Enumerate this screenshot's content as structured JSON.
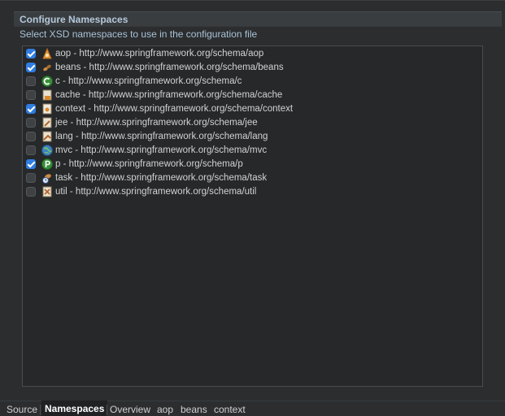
{
  "header": {
    "title": "Configure Namespaces",
    "description": "Select XSD namespaces to use in the configuration file"
  },
  "namespaces": [
    {
      "label": "aop - http://www.springframework.org/schema/aop",
      "checked": true,
      "icon": "aop-icon"
    },
    {
      "label": "beans - http://www.springframework.org/schema/beans",
      "checked": true,
      "icon": "beans-icon"
    },
    {
      "label": "c - http://www.springframework.org/schema/c",
      "checked": false,
      "icon": "c-namespace-icon"
    },
    {
      "label": "cache - http://www.springframework.org/schema/cache",
      "checked": false,
      "icon": "cache-icon"
    },
    {
      "label": "context - http://www.springframework.org/schema/context",
      "checked": true,
      "icon": "context-icon"
    },
    {
      "label": "jee - http://www.springframework.org/schema/jee",
      "checked": false,
      "icon": "jee-icon"
    },
    {
      "label": "lang - http://www.springframework.org/schema/lang",
      "checked": false,
      "icon": "lang-icon"
    },
    {
      "label": "mvc - http://www.springframework.org/schema/mvc",
      "checked": false,
      "icon": "mvc-globe-icon"
    },
    {
      "label": "p - http://www.springframework.org/schema/p",
      "checked": true,
      "icon": "p-namespace-icon"
    },
    {
      "label": "task - http://www.springframework.org/schema/task",
      "checked": false,
      "icon": "task-icon"
    },
    {
      "label": "util - http://www.springframework.org/schema/util",
      "checked": false,
      "icon": "util-icon"
    }
  ],
  "tabs": [
    {
      "label": "Source",
      "active": false
    },
    {
      "label": "Namespaces",
      "active": true
    },
    {
      "label": "Overview",
      "active": false
    },
    {
      "label": "aop",
      "active": false
    },
    {
      "label": "beans",
      "active": false
    },
    {
      "label": "context",
      "active": false
    }
  ],
  "colors": {
    "background": "#2b2d2f",
    "list_background": "#26282a",
    "checkbox_checked": "#2f7de1",
    "header_text": "#b4c8da"
  }
}
